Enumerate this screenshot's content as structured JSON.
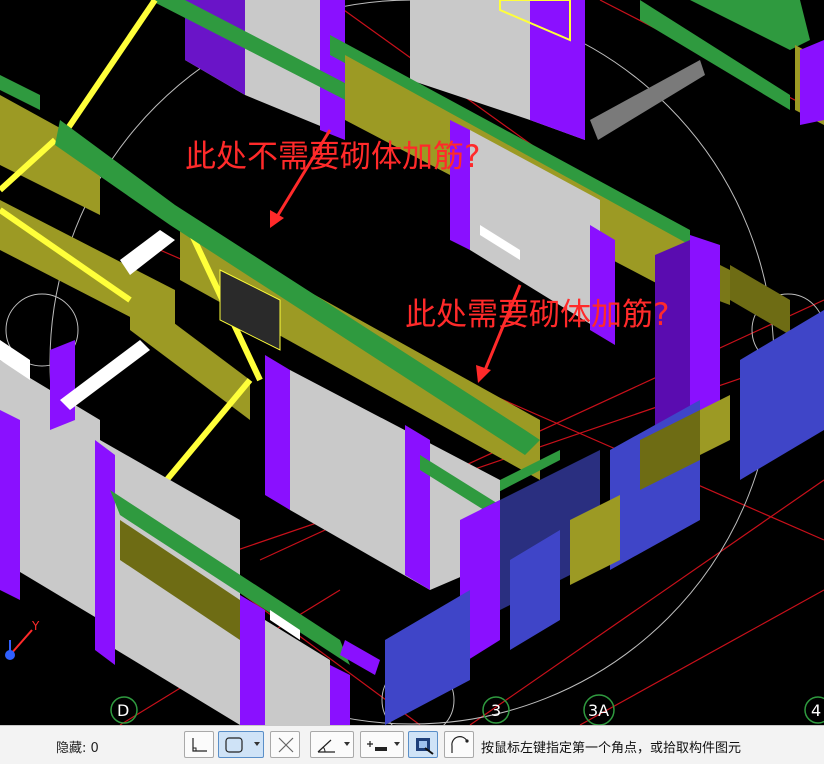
{
  "viewport": {
    "annotations": [
      {
        "text": "此处不需要砌体加筋?"
      },
      {
        "text": "此处需要砌体加筋?"
      }
    ],
    "axis_labels": [
      "D",
      "3",
      "3A",
      "4"
    ],
    "gizmo_axis": "Y"
  },
  "statusbar": {
    "hidden_count_label": "隐藏: 0",
    "hint_text": "按鼠标左键指定第一个角点，或拾取构件图元",
    "tools": [
      {
        "name": "orthogonal-tool",
        "icon": "orthogonal-icon"
      },
      {
        "name": "rect-select-tool",
        "icon": "rect-select-icon"
      },
      {
        "name": "cross-select-tool",
        "icon": "cross-icon"
      },
      {
        "name": "angle-tool",
        "icon": "angle-icon"
      },
      {
        "name": "offset-tool",
        "icon": "offset-icon"
      },
      {
        "name": "pick-element-tool",
        "icon": "pick-element-icon"
      },
      {
        "name": "arc-tool",
        "icon": "arc-icon"
      }
    ]
  },
  "colors": {
    "background": "#000000",
    "wall_grey": "#c9c9c9",
    "column_purple": "#8a10ff",
    "beam_green": "#2f9a3f",
    "lintel_olive": "#9c9a24",
    "outline_yellow": "#ffff3a",
    "grid_red": "#c8101a",
    "window_blue": "#3f45c8",
    "annotation_red": "#ff2a2a"
  }
}
